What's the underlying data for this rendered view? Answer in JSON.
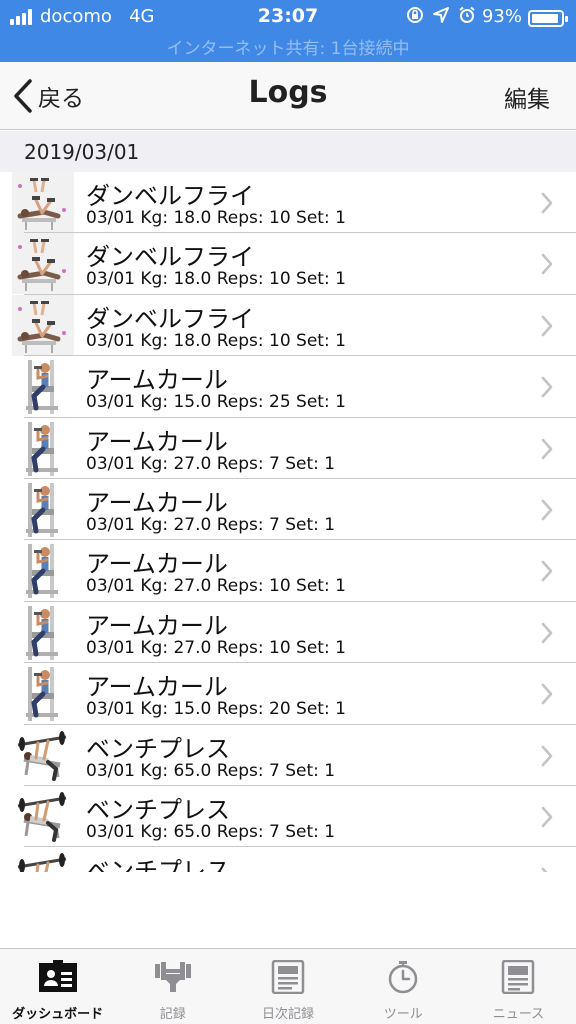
{
  "status_bar": {
    "carrier": "docomo",
    "network": "4G",
    "time": "23:07",
    "battery_text": "93%",
    "battery_level": 0.93,
    "icons": [
      "orientation-lock-icon",
      "location-arrow-icon",
      "alarm-icon"
    ],
    "hotspot_text": "インターネット共有: 1台接続中"
  },
  "nav": {
    "back_label": "戻る",
    "title": "Logs",
    "edit_label": "編集"
  },
  "section": {
    "date": "2019/03/01"
  },
  "logs": [
    {
      "exercise": "ダンベルフライ",
      "detail": "03/01  Kg: 18.0  Reps: 10  Set: 1",
      "icon": "dumbbell-fly-icon"
    },
    {
      "exercise": "ダンベルフライ",
      "detail": "03/01  Kg: 18.0  Reps: 10  Set: 1",
      "icon": "dumbbell-fly-icon"
    },
    {
      "exercise": "ダンベルフライ",
      "detail": "03/01  Kg: 18.0  Reps: 10  Set: 1",
      "icon": "dumbbell-fly-icon"
    },
    {
      "exercise": "アームカール",
      "detail": "03/01  Kg: 15.0  Reps: 25  Set: 1",
      "icon": "arm-curl-icon"
    },
    {
      "exercise": "アームカール",
      "detail": "03/01  Kg: 27.0  Reps: 7  Set: 1",
      "icon": "arm-curl-icon"
    },
    {
      "exercise": "アームカール",
      "detail": "03/01  Kg: 27.0  Reps: 7  Set: 1",
      "icon": "arm-curl-icon"
    },
    {
      "exercise": "アームカール",
      "detail": "03/01  Kg: 27.0  Reps: 10  Set: 1",
      "icon": "arm-curl-icon"
    },
    {
      "exercise": "アームカール",
      "detail": "03/01  Kg: 27.0  Reps: 10  Set: 1",
      "icon": "arm-curl-icon"
    },
    {
      "exercise": "アームカール",
      "detail": "03/01  Kg: 15.0  Reps: 20  Set: 1",
      "icon": "arm-curl-icon"
    },
    {
      "exercise": "ベンチプレス",
      "detail": "03/01  Kg: 65.0  Reps: 7  Set: 1",
      "icon": "bench-press-icon"
    },
    {
      "exercise": "ベンチプレス",
      "detail": "03/01  Kg: 65.0  Reps: 7  Set: 1",
      "icon": "bench-press-icon"
    },
    {
      "exercise": "ベンチプレス",
      "detail": "",
      "icon": "bench-press-icon"
    }
  ],
  "tabs": [
    {
      "label": "ダッシュボード",
      "icon": "dashboard-icon",
      "active": true
    },
    {
      "label": "記録",
      "icon": "barbell-icon",
      "active": false
    },
    {
      "label": "日次記録",
      "icon": "daily-log-icon",
      "active": false
    },
    {
      "label": "ツール",
      "icon": "stopwatch-icon",
      "active": false
    },
    {
      "label": "ニュース",
      "icon": "news-icon",
      "active": false
    }
  ]
}
